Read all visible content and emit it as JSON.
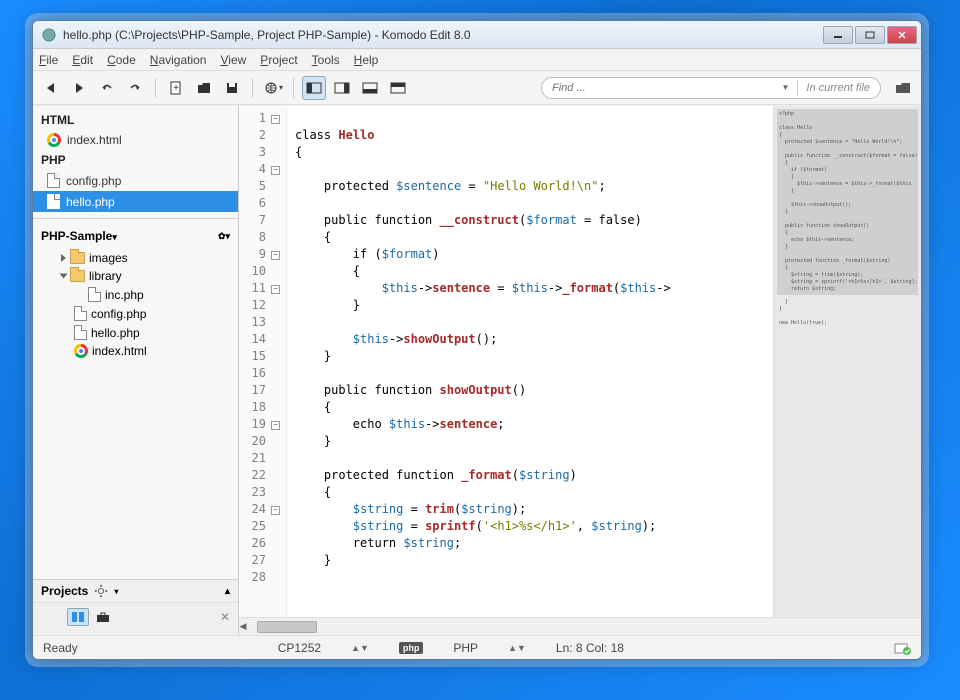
{
  "title": "hello.php (C:\\Projects\\PHP-Sample, Project PHP-Sample) - Komodo Edit 8.0",
  "menu": [
    "File",
    "Edit",
    "Code",
    "Navigation",
    "View",
    "Project",
    "Tools",
    "Help"
  ],
  "toolbar": {
    "find_placeholder": "Find ...",
    "find_scope": "In current file"
  },
  "sidebar": {
    "groups": [
      {
        "label": "HTML",
        "items": [
          {
            "label": "index.html",
            "icon": "chrome"
          }
        ]
      },
      {
        "label": "PHP",
        "items": [
          {
            "label": "config.php",
            "icon": "file"
          },
          {
            "label": "hello.php",
            "icon": "file",
            "active": true
          }
        ]
      }
    ],
    "project_name": "PHP-Sample",
    "tree": [
      {
        "label": "images",
        "icon": "folder",
        "expander": "right",
        "indent": 1
      },
      {
        "label": "library",
        "icon": "folder",
        "expander": "down",
        "indent": 1
      },
      {
        "label": "inc.php",
        "icon": "file",
        "indent": 2
      },
      {
        "label": "config.php",
        "icon": "file",
        "indent": 1
      },
      {
        "label": "hello.php",
        "icon": "file",
        "indent": 1
      },
      {
        "label": "index.html",
        "icon": "chrome",
        "indent": 1
      }
    ],
    "projects_label": "Projects"
  },
  "editor": {
    "lines": [
      {
        "n": 1,
        "fold": "minus",
        "html": "<?php"
      },
      {
        "n": 2,
        "html": ""
      },
      {
        "n": 3,
        "html": "class <span class='cls'>Hello</span>"
      },
      {
        "n": 4,
        "fold": "minus",
        "html": "{"
      },
      {
        "n": 5,
        "html": ""
      },
      {
        "n": 6,
        "html": "    protected <span class='var'>$sentence</span> = <span class='str'>\"Hello World!\\n\"</span>;"
      },
      {
        "n": 7,
        "html": ""
      },
      {
        "n": 8,
        "html": "    public function <span class='fn'>__construct</span>(<span class='var'>$format</span> = false)"
      },
      {
        "n": 9,
        "fold": "minus",
        "html": "    {"
      },
      {
        "n": 10,
        "html": "        if (<span class='var'>$format</span>)"
      },
      {
        "n": 11,
        "fold": "minus",
        "html": "        {"
      },
      {
        "n": 12,
        "html": "            <span class='var'>$this</span>-><span class='fn'>sentence</span> = <span class='var'>$this</span>-><span class='fn'>_format</span>(<span class='var'>$this</span>->"
      },
      {
        "n": 13,
        "html": "        }"
      },
      {
        "n": 14,
        "html": ""
      },
      {
        "n": 15,
        "html": "        <span class='var'>$this</span>-><span class='fn'>showOutput</span>();"
      },
      {
        "n": 16,
        "html": "    }"
      },
      {
        "n": 17,
        "html": ""
      },
      {
        "n": 18,
        "html": "    public function <span class='fn'>showOutput</span>()"
      },
      {
        "n": 19,
        "fold": "minus",
        "html": "    {"
      },
      {
        "n": 20,
        "html": "        echo <span class='var'>$this</span>-><span class='fn'>sentence</span>;"
      },
      {
        "n": 21,
        "html": "    }"
      },
      {
        "n": 22,
        "html": ""
      },
      {
        "n": 23,
        "html": "    protected function <span class='fn'>_format</span>(<span class='var'>$string</span>)"
      },
      {
        "n": 24,
        "fold": "minus",
        "html": "    {"
      },
      {
        "n": 25,
        "html": "        <span class='var'>$string</span> = <span class='fn'>trim</span>(<span class='var'>$string</span>);"
      },
      {
        "n": 26,
        "html": "        <span class='var'>$string</span> = <span class='fn'>sprintf</span>(<span class='str'>'&lt;h1&gt;%s&lt;/h1&gt;'</span>, <span class='var'>$string</span>);"
      },
      {
        "n": 27,
        "html": "        return <span class='var'>$string</span>;"
      },
      {
        "n": 28,
        "html": "    }"
      }
    ]
  },
  "minimap_text": "<?php\n\nclass Hello\n{\n  protected $sentence = \"Hello World!\\n\";\n\n  public function __construct($format = false)\n  {\n    if ($format)\n    {\n      $this->sentence = $this->_format($this\n    }\n\n    $this->showOutput();\n  }\n\n  public function showOutput()\n  {\n    echo $this->sentence;\n  }\n\n  protected function _format($string)\n  {\n    $string = trim($string);\n    $string = sprintf('<h1>%s</h1>', $string);\n    return $string;\n  }\n}\n\nnew Hello(true);",
  "status": {
    "ready": "Ready",
    "encoding": "CP1252",
    "lang_label": "PHP",
    "lang_badge": "php",
    "pos": "Ln: 8 Col: 18"
  }
}
